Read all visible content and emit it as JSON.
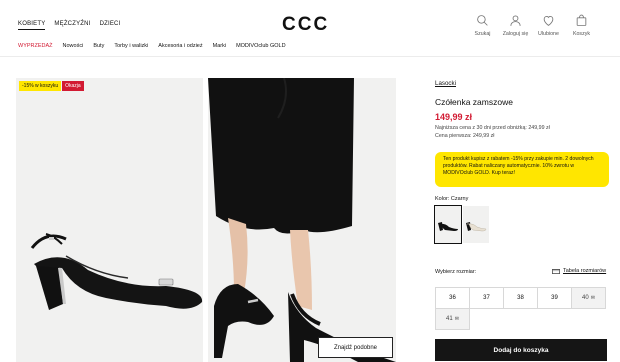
{
  "header": {
    "gender_tabs": [
      {
        "label": "KOBIETY",
        "active": true
      },
      {
        "label": "MĘŻCZYŹNI",
        "active": false
      },
      {
        "label": "DZIECI",
        "active": false
      }
    ],
    "logo": "CCC",
    "icons": [
      {
        "icon": "search-icon",
        "label": "Szukaj"
      },
      {
        "icon": "user-icon",
        "label": "Zaloguj się"
      },
      {
        "icon": "heart-icon",
        "label": "Ulubione"
      },
      {
        "icon": "bag-icon",
        "label": "Koszyk"
      }
    ],
    "nav": [
      "WYPRZEDAŻ",
      "Nowości",
      "Buty",
      "Torby i walizki",
      "Akcesoria i odzież",
      "Marki",
      "MODIVOclub GOLD"
    ],
    "sale_color": "#d21a32"
  },
  "gallery": {
    "badges": [
      "-15% w koszyku",
      "Okazja"
    ],
    "similar_button": "Znajdź podobne"
  },
  "product": {
    "brand": "Lasocki",
    "name": "Czółenka zamszowe",
    "price": "149,99 zł",
    "lowest_price": "Najniższa cena z 30 dni przed obniżką: 249,99 zł",
    "first_price": "Cena pierwsza: 249,99 zł",
    "promo": "Ten produkt kupisz z rabatem -15% przy zakupie min. 2 dowolnych produktów. Rabat naliczany automatycznie. 10% zwrotu w MODIVOclub GOLD. Kup teraz!",
    "color_label": "Kolor: Czarny",
    "colors": [
      {
        "name": "black",
        "hex": "#111111",
        "selected": true
      },
      {
        "name": "beige",
        "hex": "#e8e0d2",
        "selected": false
      }
    ],
    "size_label": "Wybierz rozmiar:",
    "size_table": "Tabela rozmiarów",
    "sizes": [
      {
        "value": "36",
        "low_stock": false
      },
      {
        "value": "37",
        "low_stock": false
      },
      {
        "value": "38",
        "low_stock": false
      },
      {
        "value": "39",
        "low_stock": false
      },
      {
        "value": "40",
        "low_stock": true
      },
      {
        "value": "41",
        "low_stock": true
      }
    ],
    "add_to_cart": "Dodaj do koszyka"
  },
  "colors": {
    "accent_red": "#d21a32",
    "promo_yellow": "#ffe600",
    "button_dark": "#151515"
  }
}
